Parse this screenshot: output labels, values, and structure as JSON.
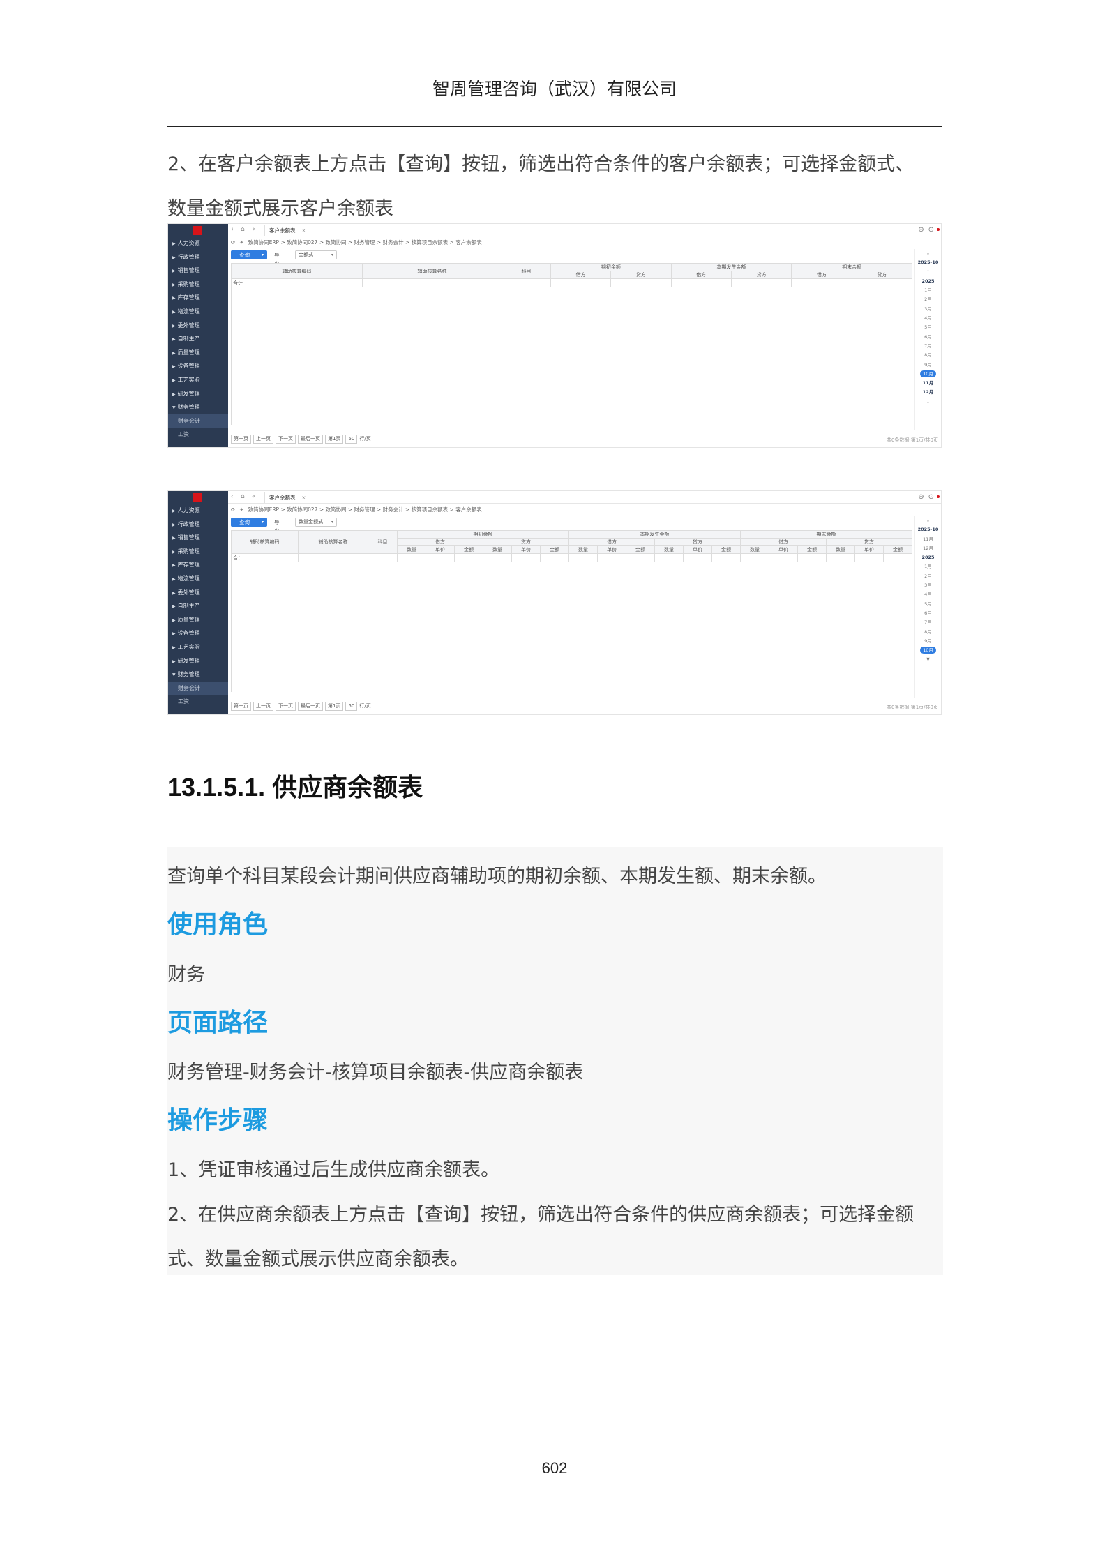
{
  "header": {
    "company": "智周管理咨询（武汉）有限公司"
  },
  "intro": {
    "line1": "2、在客户余额表上方点击【查询】按钮，筛选出符合条件的客户余额表；可选择金额式、",
    "line2": "数量金额式展示客户余额表"
  },
  "app_shared": {
    "sidebar_items": [
      "人力资源",
      "行政管理",
      "销售管理",
      "采购管理",
      "库存管理",
      "物流管理",
      "委外管理",
      "自制生产",
      "质量管理",
      "设备管理",
      "工艺实验",
      "研发管理",
      "财务管理"
    ],
    "sidebar_subitems": [
      "财务会计",
      "工资"
    ],
    "tab_label": "客户余额表",
    "breadcrumb": "致简协同ERP > 致简协同027 > 致简协同 > 财务管理 > 财务会计 > 核算项目余额表 > 客户余额表",
    "query_label": "查询",
    "export_label": "导出",
    "col_item_code": "辅助核算编码",
    "col_item_name": "辅助核算名称",
    "col_subject": "科目",
    "col_opening": "期初余额",
    "col_current": "本期发生金额",
    "col_ending": "期末余额",
    "debit": "借方",
    "credit": "贷方",
    "qty": "数量",
    "price": "单价",
    "amount": "金额",
    "total_row": "合计",
    "pager_first": "第一页",
    "pager_prev": "上一页",
    "pager_next": "下一页",
    "pager_last": "最后一页",
    "pager_page": "第1页",
    "pager_size": "50",
    "pager_size_unit": "行/页",
    "pager_total": "共0条数据 第1页/共0页"
  },
  "app1": {
    "mode": "金额式",
    "period_label": "2025-10",
    "year": "2025",
    "months": [
      "1月",
      "2月",
      "3月",
      "4月",
      "5月",
      "6月",
      "7月",
      "8月",
      "9月"
    ],
    "selected_month": "10月",
    "tail_months": [
      "11月",
      "12月"
    ]
  },
  "app2": {
    "mode": "数量金额式",
    "period_label": "2025-10",
    "prev_months": [
      "11月",
      "12月"
    ],
    "year": "2025",
    "months": [
      "1月",
      "2月",
      "3月",
      "4月",
      "5月",
      "6月",
      "7月",
      "8月",
      "9月"
    ],
    "selected_month": "10月"
  },
  "section": {
    "heading": "13.1.5.1.  供应商余额表",
    "description": "查询单个科目某段会计期间供应商辅助项的期初余额、本期发生额、期末余额。",
    "role_heading": "使用角色",
    "role": "财务",
    "path_heading": "页面路径",
    "path": "财务管理-财务会计-核算项目余额表-供应商余额表",
    "steps_heading": "操作步骤",
    "step1": "1、凭证审核通过后生成供应商余额表。",
    "step2_line1": "2、在供应商余额表上方点击【查询】按钮，筛选出符合条件的供应商余额表；可选择金额",
    "step2_line2": "式、数量金额式展示供应商余额表。"
  },
  "footer": {
    "page_number": "602"
  },
  "colors": {
    "accent_blue": "#1d9be0",
    "sidebar_bg": "#2b3a52",
    "button_blue": "#2f7de1"
  }
}
